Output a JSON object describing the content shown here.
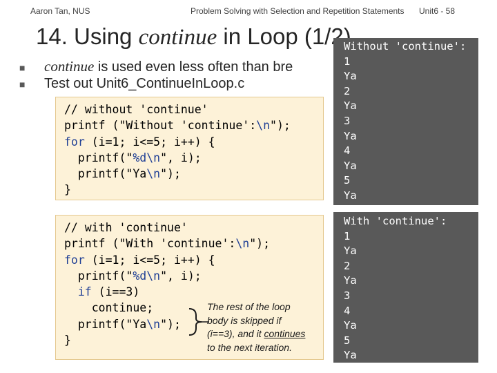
{
  "header": {
    "author": "Aaron Tan, NUS",
    "title": "Problem Solving with Selection and Repetition Statements",
    "slide": "Unit6 - 58"
  },
  "slide": {
    "title_prefix": "14. Using ",
    "title_keyword": "continue",
    "title_suffix": " in Loop (1/2)"
  },
  "bullets": [
    {
      "icon": "square-bullet-icon",
      "keyword": "continue",
      "text": " is used even less often than bre"
    },
    {
      "icon": "square-bullet-icon",
      "text": "Test out Unit6_ContinueInLoop.c"
    }
  ],
  "code_without": [
    "// without 'continue'",
    "printf (\"Without 'continue':\\n\");",
    "for (i=1; i<=5; i++) {",
    "  printf(\"%d\\n\", i);",
    "  printf(\"Ya\\n\");",
    "}"
  ],
  "code_with": [
    "// with 'continue'",
    "printf (\"With 'continue':\\n\");",
    "for (i=1; i<=5; i++) {",
    "  printf(\"%d\\n\", i);",
    "  if (i==3)",
    "    continue;",
    "  printf(\"Ya\\n\");",
    "}"
  ],
  "annotation": {
    "line1": "The rest of the loop",
    "line2": "body is skipped if",
    "line3a": "(i==3), and it ",
    "line3b": "continues",
    "line4": "to the next iteration."
  },
  "output_without": [
    "Without 'continue':",
    "1",
    "Ya",
    "2",
    "Ya",
    "3",
    "Ya",
    "4",
    "Ya",
    "5",
    "Ya"
  ],
  "output_with": [
    "With 'continue':",
    "1",
    "Ya",
    "2",
    "Ya",
    "3",
    "4",
    "Ya",
    "5",
    "Ya"
  ],
  "colors": {
    "code_bg": "#fdf2d8",
    "keyword": "#1f3f95",
    "output_bg": "#595959",
    "output_fg": "#ffffff"
  }
}
